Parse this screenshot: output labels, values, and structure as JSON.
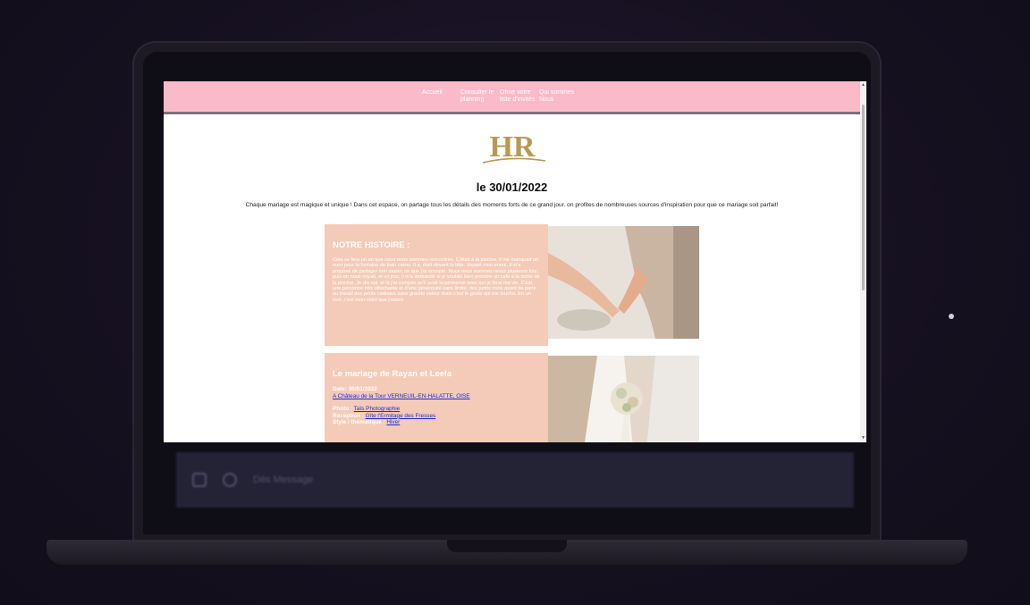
{
  "nav": {
    "items": [
      {
        "label": "Accueil"
      },
      {
        "label": "Consulter le planning"
      },
      {
        "label": "Ohné votre liste d'invités"
      },
      {
        "label": "Qui sommes Nous"
      }
    ]
  },
  "header": {
    "logo_text": "HR",
    "date": "le 30/01/2022",
    "intro": "Chaque mariage est magique et unique ! Dans cet espace, on partage tous les détails des moments forts de ce grand jour. on profites de nombreuses sources d'inspiration pour que ce mariage soit parfait!"
  },
  "story": {
    "title": "NOTRE HISTOIRE :",
    "body": "Cela se fera un an que nous nous sommes rencontrés. C'était à la piscine, il me manquait un euro pour la fontaine de bain carrer. Il a, était devant la tête. Voyant mon ennui, il m'a proposé de partager son casier, ce que j'ai accepté. Nous nous sommes revus plusieurs fois, puis on nous voyait, et un jour, il m'a demandé si je voulais bien prendre un café à la sortie de la piscine. Je dis oui, et là j'ai compris qu'il avait la personne avec qui je ferai ma vie. C'est une personne très attachante et d'une générosité sans limite, des petits mots avant de partir au travail des petits cadeaux sans grande valeur mais c'est le geste qui me touche. En un mot, c'est mon chéri que j'adore."
  },
  "wedding": {
    "title": "Le mariage de Rayan et Leela",
    "date_line": "Date: 30/01/2022",
    "venue": "A Château de la Tour VERNEUIL-EN-HALATTE, OISE",
    "photo_label": "Photo :",
    "photo_value": "Taïs Photographie",
    "reception_label": "Réception :",
    "reception_value": "Gîte l'Ermitage des Fresses",
    "style_label": "Style / thématique :",
    "style_value": "Hiver"
  },
  "taskbar": {
    "text": "Dés Message"
  },
  "colors": {
    "nav_bg": "#fbbac7",
    "card_bg": "#f4cbb8",
    "link": "#1b2fd6",
    "logo_gold": "#b79a52"
  }
}
